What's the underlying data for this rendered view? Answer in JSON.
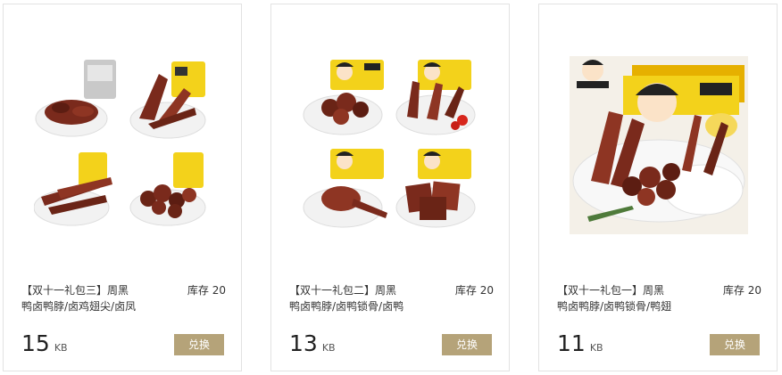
{
  "products": [
    {
      "title_line1": "【双十一礼包三】周黑",
      "title_line2": "鸭卤鸭脖/卤鸡翅尖/卤凤",
      "stock": "库存 20",
      "price": "15",
      "unit": "KB",
      "button": "兑换"
    },
    {
      "title_line1": "【双十一礼包二】周黑",
      "title_line2": "鸭卤鸭脖/卤鸭锁骨/卤鸭",
      "stock": "库存 20",
      "price": "13",
      "unit": "KB",
      "button": "兑换"
    },
    {
      "title_line1": "【双十一礼包一】周黑",
      "title_line2": "鸭卤鸭脖/卤鸭锁骨/鸭翅",
      "stock": "库存 20",
      "price": "11",
      "unit": "KB",
      "button": "兑换"
    }
  ],
  "colors": {
    "button": "#b5a379",
    "package_yellow": "#f3d21b",
    "braised_meat": "#7a2a1c"
  }
}
